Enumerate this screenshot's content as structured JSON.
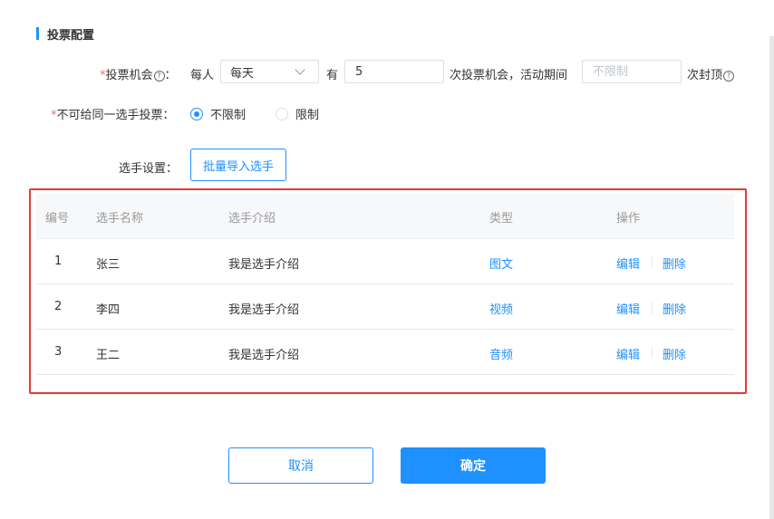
{
  "section": {
    "title": "投票配置"
  },
  "vote_chance": {
    "required_mark": "*",
    "label": "投票机会",
    "help_glyph": "?",
    "colon": "：",
    "per_person": "每人",
    "period_selected": "每天",
    "have": "有",
    "count_value": "5",
    "times_text": "次投票机会，活动期间",
    "cap_placeholder": "不限制",
    "cap_suffix": "次封顶"
  },
  "same_player": {
    "required_mark": "*",
    "label": "不可给同一选手投票：",
    "options": [
      {
        "label": "不限制",
        "checked": true
      },
      {
        "label": "限制",
        "checked": false
      }
    ]
  },
  "player_settings": {
    "label": "选手设置：",
    "import_button": "批量导入选手"
  },
  "table": {
    "columns": [
      "编号",
      "选手名称",
      "选手介绍",
      "类型",
      "操作"
    ],
    "rows": [
      {
        "id": "1",
        "name": "张三",
        "intro": "我是选手介绍",
        "type": "图文",
        "edit": "编辑",
        "delete": "删除"
      },
      {
        "id": "2",
        "name": "李四",
        "intro": "我是选手介绍",
        "type": "视频",
        "edit": "编辑",
        "delete": "删除"
      },
      {
        "id": "3",
        "name": "王二",
        "intro": "我是选手介绍",
        "type": "音频",
        "edit": "编辑",
        "delete": "删除"
      }
    ]
  },
  "footer": {
    "cancel": "取消",
    "confirm": "确定"
  },
  "colors": {
    "accent": "#1e90ff",
    "required": "#f56c6c",
    "highlight_border": "#e53935"
  }
}
